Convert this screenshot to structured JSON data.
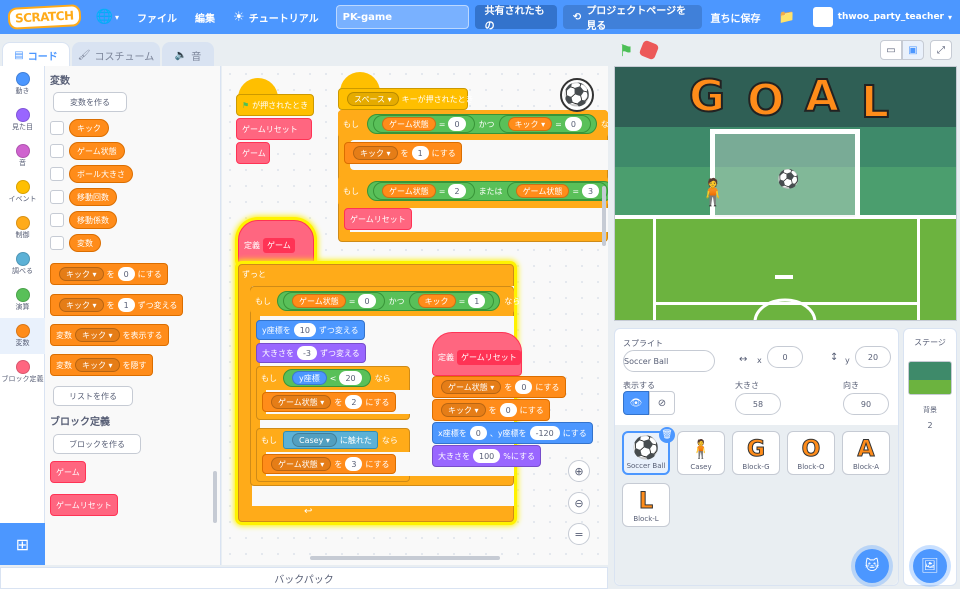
{
  "menubar": {
    "logo": "SCRATCH",
    "file": "ファイル",
    "edit": "編集",
    "tutorials": "チュートリアル",
    "project_title": "PK-game",
    "share": "共有されたもの",
    "see_project_page": "プロジェクトページを見る",
    "save_now": "直ちに保存",
    "username": "thwoo_party_teacher"
  },
  "tabs": {
    "code": "コード",
    "costumes": "コスチューム",
    "sounds": "音"
  },
  "categories": [
    {
      "label": "動き",
      "color": "#4c97ff"
    },
    {
      "label": "見た目",
      "color": "#9966ff"
    },
    {
      "label": "音",
      "color": "#cf63cf"
    },
    {
      "label": "イベント",
      "color": "#ffbf00"
    },
    {
      "label": "制御",
      "color": "#ffab19"
    },
    {
      "label": "調べる",
      "color": "#5cb1d6"
    },
    {
      "label": "演算",
      "color": "#59c059"
    },
    {
      "label": "変数",
      "color": "#ff8c1a"
    },
    {
      "label": "ブロック定義",
      "color": "#ff6680"
    }
  ],
  "palette": {
    "variables_heading": "変数",
    "make_variable": "変数を作る",
    "variables": [
      "キック",
      "ゲーム状態",
      "ボール大きさ",
      "移動回数",
      "移動係数",
      "変数"
    ],
    "set_to": {
      "var": "キック",
      "mid": "を",
      "value": "0",
      "end": "にする"
    },
    "change_by": {
      "var": "キック",
      "mid": "を",
      "value": "1",
      "end": "ずつ変える"
    },
    "show_var": {
      "pre": "変数",
      "var": "キック",
      "end": "を表示する"
    },
    "hide_var": {
      "pre": "変数",
      "var": "キック",
      "end": "を隠す"
    },
    "make_list": "リストを作る",
    "my_blocks_heading": "ブロック定義",
    "make_block": "ブロックを作る",
    "my_blocks": [
      "ゲーム",
      "ゲームリセット"
    ]
  },
  "scripts": {
    "s1_hat": "が押されたとき",
    "s1_b1": "ゲームリセット",
    "s1_b2": "ゲーム",
    "s2_hat_key": "スペース",
    "s2_hat": "キーが押されたとき",
    "if": "もし",
    "then": "なら",
    "and": "かつ",
    "or": "または",
    "game_state": "ゲーム状態",
    "kick": "キック",
    "eq": "=",
    "v0": "0",
    "v1": "1",
    "v2": "2",
    "v3": "3",
    "set_end": "にする",
    "set_mid": "を",
    "s2_reset": "ゲームリセット",
    "define": "定義",
    "game": "ゲーム",
    "forever": "ずっと",
    "change_y": "y座標を",
    "change_y_val": "10",
    "change_y_end": "ずつ変える",
    "change_size": "大きさを",
    "change_size_val": "-3",
    "change_size_end": "ずつ変える",
    "y_pos": "y座標",
    "lt": "<",
    "v20": "20",
    "casey": "Casey",
    "touching": "に触れた",
    "define_reset": "ゲームリセット",
    "goto_x": "x座標を",
    "goto_x_val": "0",
    "goto_y": "、y座標を",
    "goto_y_val": "-120",
    "size_to": "大きさを",
    "size_val": "100",
    "size_end": "%にする"
  },
  "backpack": "バックパック",
  "sprite_info": {
    "sprite_label": "スプライト",
    "sprite_name": "Soccer Ball",
    "x_label": "x",
    "x": "0",
    "y_label": "y",
    "y": "20",
    "show_label": "表示する",
    "size_label": "大きさ",
    "size": "58",
    "direction_label": "向き",
    "direction": "90"
  },
  "sprites": [
    "Soccer Ball",
    "Casey",
    "Block-G",
    "Block-O",
    "Block-A",
    "Block-L"
  ],
  "sprite_glyphs": [
    "⚽",
    "🧍",
    "G",
    "O",
    "A",
    "L"
  ],
  "stage_pane": {
    "label": "ステージ",
    "backdrops_label": "背景",
    "backdrops": "2"
  },
  "stage_text": [
    "G",
    "O",
    "A",
    "L"
  ]
}
